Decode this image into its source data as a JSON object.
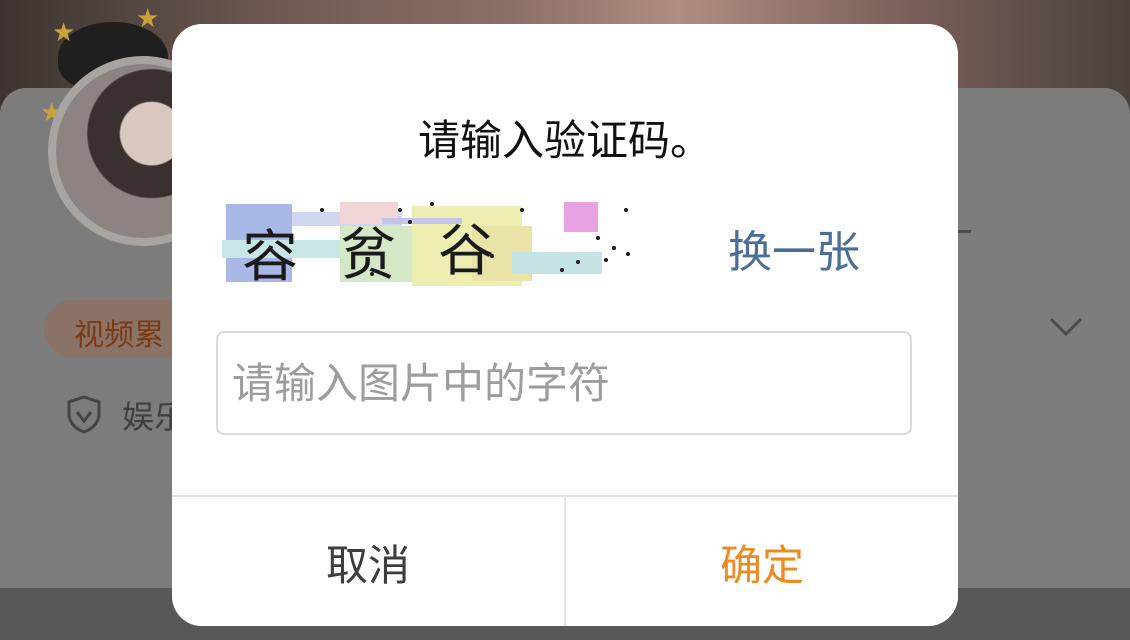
{
  "background": {
    "tag_label": "视频累",
    "entertainment_label": "娱乐"
  },
  "dialog": {
    "title": "请输入验证码。",
    "captcha_characters": [
      "容",
      "贫",
      "谷"
    ],
    "refresh_label": "换一张",
    "input": {
      "value": "",
      "placeholder": "请输入图片中的字符"
    },
    "cancel_label": "取消",
    "confirm_label": "确定"
  },
  "colors": {
    "confirm": "#ee8a22",
    "refresh_link": "#4a6d99",
    "overlay": "rgba(0,0,0,0.5)"
  }
}
